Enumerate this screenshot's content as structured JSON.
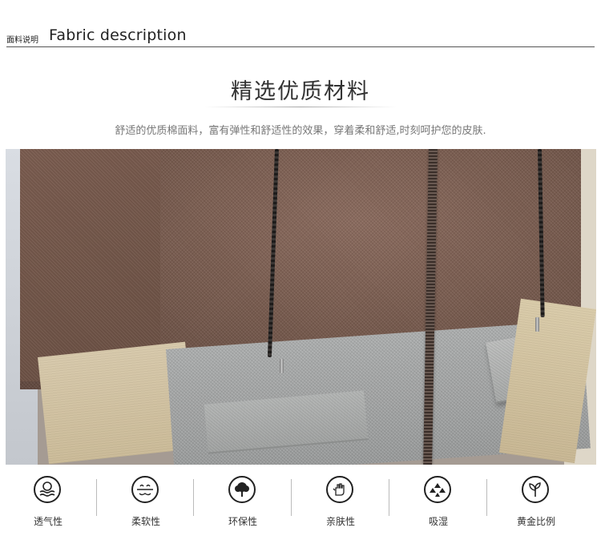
{
  "header": {
    "title_cn": "面料说明",
    "title_en": "Fabric description"
  },
  "hero": {
    "headline": "精选优质材料",
    "subline": "舒适的优质棉面料，富有弹性和舒适性的效果，穿着柔和舒适,时刻呵护您的皮肤."
  },
  "photo": {
    "subject": "fabric-closeup"
  },
  "features": [
    {
      "label": "透气性",
      "icon": "breathable-icon"
    },
    {
      "label": "柔软性",
      "icon": "soft-icon"
    },
    {
      "label": "环保性",
      "icon": "eco-tree-icon"
    },
    {
      "label": "亲肤性",
      "icon": "skin-friendly-hand-icon"
    },
    {
      "label": "吸湿",
      "icon": "moisture-absorb-icon"
    },
    {
      "label": "黄金比例",
      "icon": "golden-ratio-leaf-icon"
    }
  ]
}
